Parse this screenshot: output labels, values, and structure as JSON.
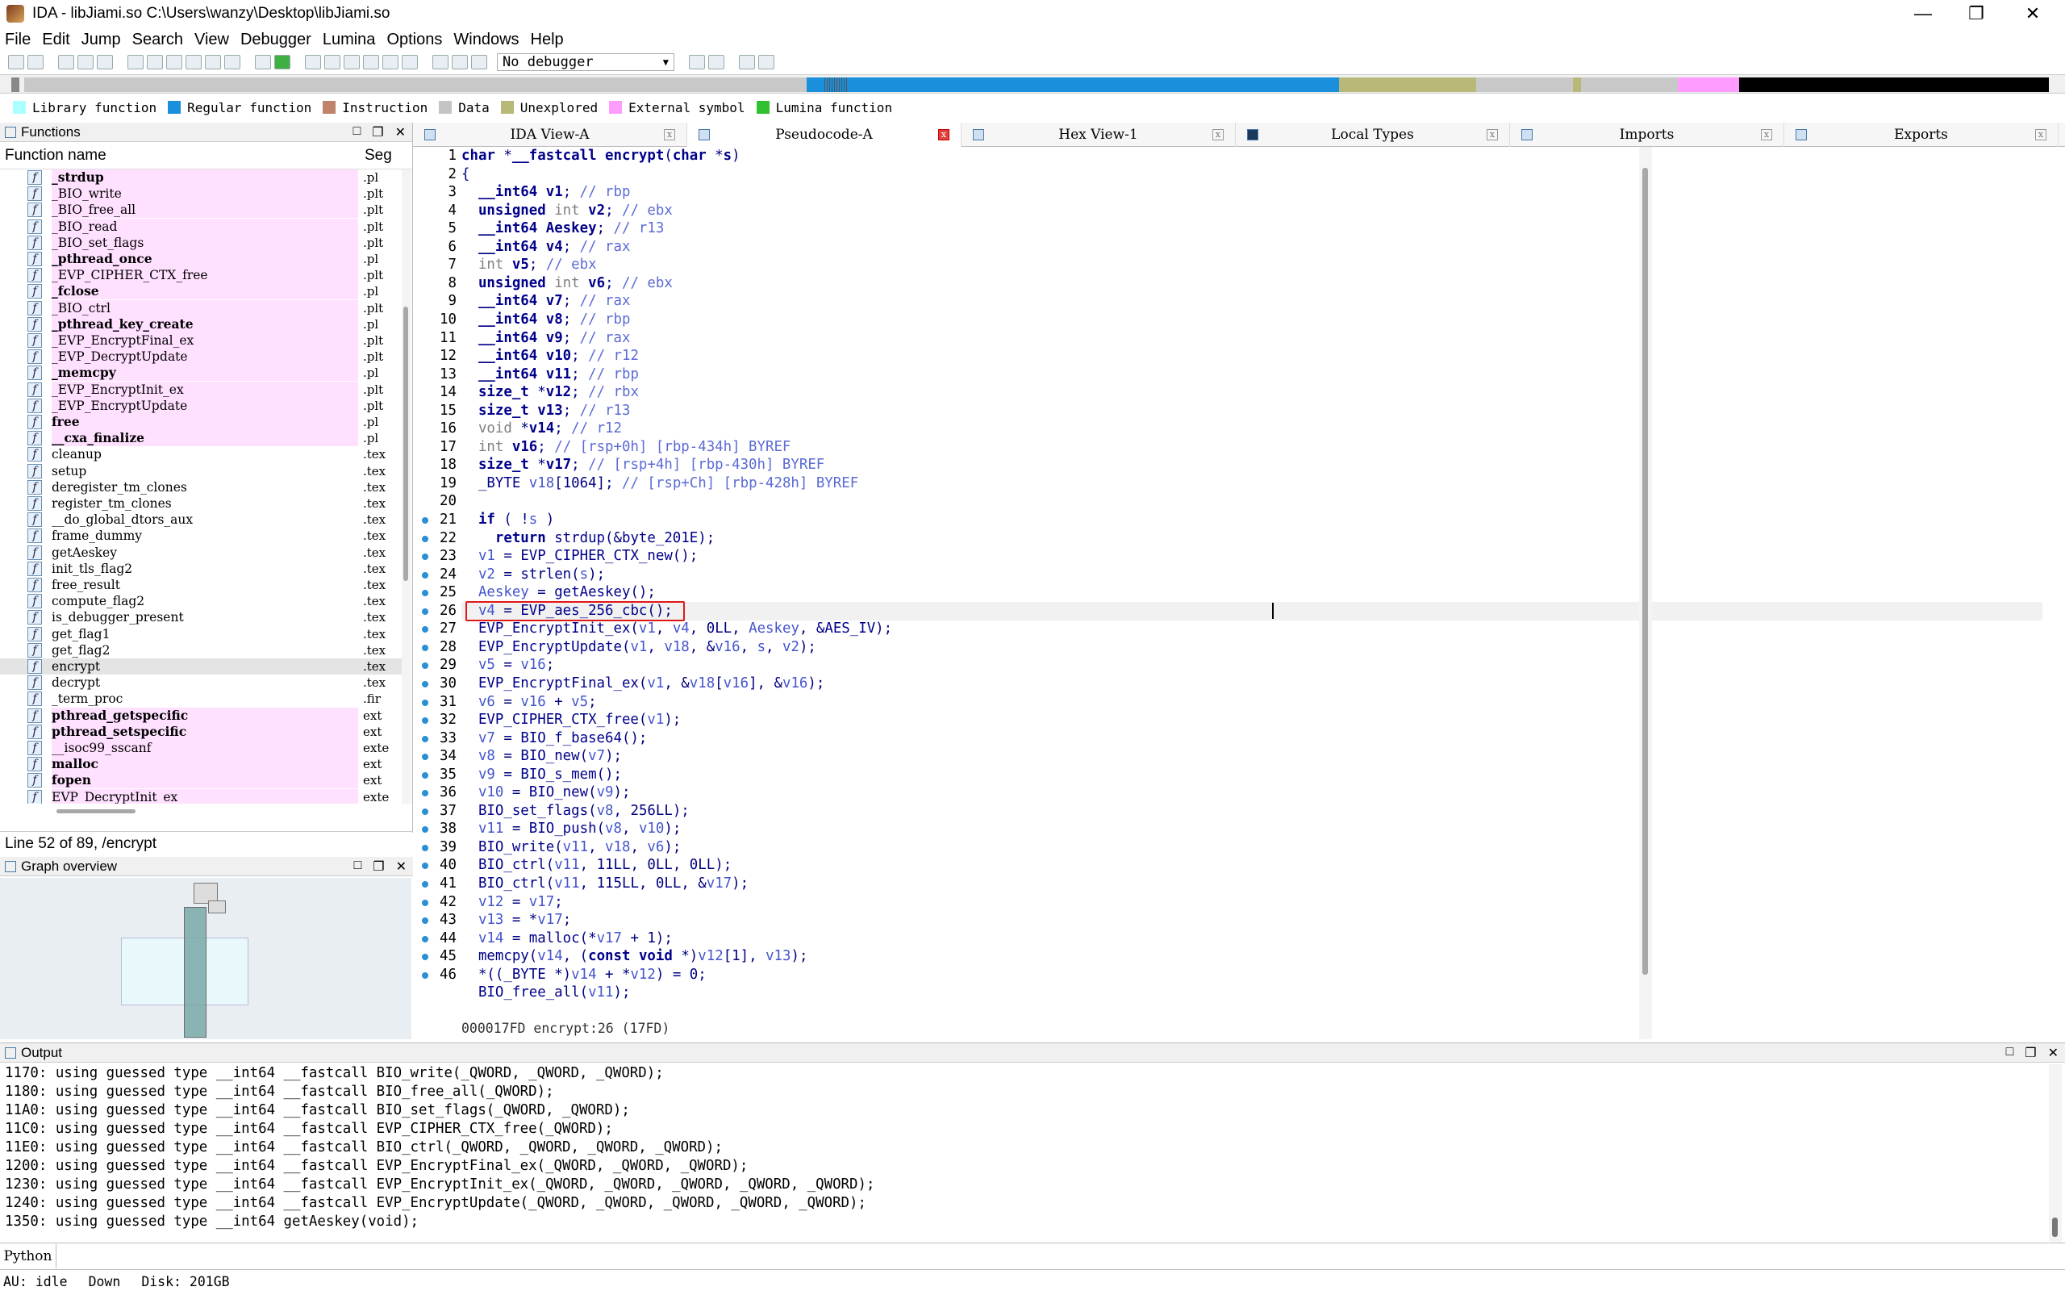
{
  "window": {
    "title": "IDA - libJiami.so C:\\Users\\wanzy\\Desktop\\libJiami.so"
  },
  "menu": [
    "File",
    "Edit",
    "Jump",
    "Search",
    "View",
    "Debugger",
    "Lumina",
    "Options",
    "Windows",
    "Help"
  ],
  "toolbar": {
    "debugger": "No debugger"
  },
  "legend": [
    {
      "label": "Library function",
      "color": "#aaffff"
    },
    {
      "label": "Regular function",
      "color": "#1a8fdc"
    },
    {
      "label": "Instruction",
      "color": "#c0826a"
    },
    {
      "label": "Data",
      "color": "#c4c4c4"
    },
    {
      "label": "Unexplored",
      "color": "#b8b878"
    },
    {
      "label": "External symbol",
      "color": "#ff9cff"
    },
    {
      "label": "Lumina function",
      "color": "#30c030"
    }
  ],
  "functions": {
    "title": "Functions",
    "col_name": "Function name",
    "col_seg": "Seg",
    "line_info": "Line 52 of 89, /encrypt",
    "rows": [
      {
        "name": "_strdup",
        "seg": ".pl",
        "lib": true,
        "bold": true
      },
      {
        "name": "_BIO_write",
        "seg": ".plt",
        "lib": true,
        "bold": false
      },
      {
        "name": "_BIO_free_all",
        "seg": ".plt",
        "lib": true,
        "bold": false
      },
      {
        "name": "_BIO_read",
        "seg": ".plt",
        "lib": true,
        "bold": false
      },
      {
        "name": "_BIO_set_flags",
        "seg": ".plt",
        "lib": true,
        "bold": false
      },
      {
        "name": "_pthread_once",
        "seg": ".pl",
        "lib": true,
        "bold": true
      },
      {
        "name": "_EVP_CIPHER_CTX_free",
        "seg": ".plt",
        "lib": true,
        "bold": false
      },
      {
        "name": "_fclose",
        "seg": ".pl",
        "lib": true,
        "bold": true
      },
      {
        "name": "_BIO_ctrl",
        "seg": ".plt",
        "lib": true,
        "bold": false
      },
      {
        "name": "_pthread_key_create",
        "seg": ".pl",
        "lib": true,
        "bold": true
      },
      {
        "name": "_EVP_EncryptFinal_ex",
        "seg": ".plt",
        "lib": true,
        "bold": false
      },
      {
        "name": "_EVP_DecryptUpdate",
        "seg": ".plt",
        "lib": true,
        "bold": false
      },
      {
        "name": "_memcpy",
        "seg": ".pl",
        "lib": true,
        "bold": true
      },
      {
        "name": "_EVP_EncryptInit_ex",
        "seg": ".plt",
        "lib": true,
        "bold": false
      },
      {
        "name": "_EVP_EncryptUpdate",
        "seg": ".plt",
        "lib": true,
        "bold": false
      },
      {
        "name": "free",
        "seg": ".pl",
        "lib": true,
        "bold": true
      },
      {
        "name": "__cxa_finalize",
        "seg": ".pl",
        "lib": true,
        "bold": true
      },
      {
        "name": "cleanup",
        "seg": ".tex",
        "lib": false,
        "bold": false
      },
      {
        "name": "setup",
        "seg": ".tex",
        "lib": false,
        "bold": false
      },
      {
        "name": "deregister_tm_clones",
        "seg": ".tex",
        "lib": false,
        "bold": false
      },
      {
        "name": "register_tm_clones",
        "seg": ".tex",
        "lib": false,
        "bold": false
      },
      {
        "name": "__do_global_dtors_aux",
        "seg": ".tex",
        "lib": false,
        "bold": false
      },
      {
        "name": "frame_dummy",
        "seg": ".tex",
        "lib": false,
        "bold": false
      },
      {
        "name": "getAeskey",
        "seg": ".tex",
        "lib": false,
        "bold": false
      },
      {
        "name": "init_tls_flag2",
        "seg": ".tex",
        "lib": false,
        "bold": false
      },
      {
        "name": "free_result",
        "seg": ".tex",
        "lib": false,
        "bold": false
      },
      {
        "name": "compute_flag2",
        "seg": ".tex",
        "lib": false,
        "bold": false
      },
      {
        "name": "is_debugger_present",
        "seg": ".tex",
        "lib": false,
        "bold": false
      },
      {
        "name": "get_flag1",
        "seg": ".tex",
        "lib": false,
        "bold": false
      },
      {
        "name": "get_flag2",
        "seg": ".tex",
        "lib": false,
        "bold": false
      },
      {
        "name": "encrypt",
        "seg": ".tex",
        "lib": false,
        "bold": false,
        "selected": true
      },
      {
        "name": "decrypt",
        "seg": ".tex",
        "lib": false,
        "bold": false
      },
      {
        "name": "_term_proc",
        "seg": ".fir",
        "lib": false,
        "bold": false
      },
      {
        "name": "pthread_getspecific",
        "seg": "ext",
        "lib": true,
        "bold": true
      },
      {
        "name": "pthread_setspecific",
        "seg": "ext",
        "lib": true,
        "bold": true
      },
      {
        "name": "__isoc99_sscanf",
        "seg": "exte",
        "lib": true,
        "bold": false
      },
      {
        "name": "malloc",
        "seg": "ext",
        "lib": true,
        "bold": true
      },
      {
        "name": "fopen",
        "seg": "ext",
        "lib": true,
        "bold": true
      },
      {
        "name": "EVP_DecryptInit_ex",
        "seg": "exte",
        "lib": true,
        "bold": false
      }
    ]
  },
  "graph_overview": {
    "title": "Graph overview"
  },
  "tabs": [
    {
      "label": "IDA View-A",
      "active": false
    },
    {
      "label": "Pseudocode-A",
      "active": true
    },
    {
      "label": "Hex View-1",
      "active": false
    },
    {
      "label": "Local Types",
      "active": false
    },
    {
      "label": "Imports",
      "active": false
    },
    {
      "label": "Exports",
      "active": false
    }
  ],
  "pseudocode": {
    "status": "000017FD encrypt:26 (17FD)",
    "highlighted_line": 26,
    "lines": [
      {
        "n": "1",
        "text": "char *__fastcall encrypt(char *s)",
        "dot": false
      },
      {
        "n": "2",
        "text": "{",
        "dot": false
      },
      {
        "n": "3",
        "text": "  __int64 v1; // rbp",
        "dot": false
      },
      {
        "n": "4",
        "text": "  unsigned int v2; // ebx",
        "dot": false
      },
      {
        "n": "5",
        "text": "  __int64 Aeskey; // r13",
        "dot": false
      },
      {
        "n": "6",
        "text": "  __int64 v4; // rax",
        "dot": false
      },
      {
        "n": "7",
        "text": "  int v5; // ebx",
        "dot": false
      },
      {
        "n": "8",
        "text": "  unsigned int v6; // ebx",
        "dot": false
      },
      {
        "n": "9",
        "text": "  __int64 v7; // rax",
        "dot": false
      },
      {
        "n": "10",
        "text": "  __int64 v8; // rbp",
        "dot": false
      },
      {
        "n": "11",
        "text": "  __int64 v9; // rax",
        "dot": false
      },
      {
        "n": "12",
        "text": "  __int64 v10; // r12",
        "dot": false
      },
      {
        "n": "13",
        "text": "  __int64 v11; // rbp",
        "dot": false
      },
      {
        "n": "14",
        "text": "  size_t *v12; // rbx",
        "dot": false
      },
      {
        "n": "15",
        "text": "  size_t v13; // r13",
        "dot": false
      },
      {
        "n": "16",
        "text": "  void *v14; // r12",
        "dot": false
      },
      {
        "n": "17",
        "text": "  int v16; // [rsp+0h] [rbp-434h] BYREF",
        "dot": false
      },
      {
        "n": "18",
        "text": "  size_t *v17; // [rsp+4h] [rbp-430h] BYREF",
        "dot": false
      },
      {
        "n": "19",
        "text": "  _BYTE v18[1064]; // [rsp+Ch] [rbp-428h] BYREF",
        "dot": false
      },
      {
        "n": "20",
        "text": "",
        "dot": false
      },
      {
        "n": "21",
        "text": "  if ( !s )",
        "dot": true
      },
      {
        "n": "22",
        "text": "    return strdup(&byte_201E);",
        "dot": true
      },
      {
        "n": "23",
        "text": "  v1 = EVP_CIPHER_CTX_new();",
        "dot": true
      },
      {
        "n": "24",
        "text": "  v2 = strlen(s);",
        "dot": true
      },
      {
        "n": "25",
        "text": "  Aeskey = getAeskey();",
        "dot": true
      },
      {
        "n": "26",
        "text": "  v4 = EVP_aes_256_cbc();",
        "dot": true
      },
      {
        "n": "27",
        "text": "  EVP_EncryptInit_ex(v1, v4, 0LL, Aeskey, &AES_IV);",
        "dot": true
      },
      {
        "n": "28",
        "text": "  EVP_EncryptUpdate(v1, v18, &v16, s, v2);",
        "dot": true
      },
      {
        "n": "29",
        "text": "  v5 = v16;",
        "dot": true
      },
      {
        "n": "30",
        "text": "  EVP_EncryptFinal_ex(v1, &v18[v16], &v16);",
        "dot": true
      },
      {
        "n": "31",
        "text": "  v6 = v16 + v5;",
        "dot": true
      },
      {
        "n": "32",
        "text": "  EVP_CIPHER_CTX_free(v1);",
        "dot": true
      },
      {
        "n": "33",
        "text": "  v7 = BIO_f_base64();",
        "dot": true
      },
      {
        "n": "34",
        "text": "  v8 = BIO_new(v7);",
        "dot": true
      },
      {
        "n": "35",
        "text": "  v9 = BIO_s_mem();",
        "dot": true
      },
      {
        "n": "36",
        "text": "  v10 = BIO_new(v9);",
        "dot": true
      },
      {
        "n": "37",
        "text": "  BIO_set_flags(v8, 256LL);",
        "dot": true
      },
      {
        "n": "38",
        "text": "  v11 = BIO_push(v8, v10);",
        "dot": true
      },
      {
        "n": "39",
        "text": "  BIO_write(v11, v18, v6);",
        "dot": true
      },
      {
        "n": "40",
        "text": "  BIO_ctrl(v11, 11LL, 0LL, 0LL);",
        "dot": true
      },
      {
        "n": "41",
        "text": "  BIO_ctrl(v11, 115LL, 0LL, &v17);",
        "dot": true
      },
      {
        "n": "42",
        "text": "  v12 = v17;",
        "dot": true
      },
      {
        "n": "43",
        "text": "  v13 = *v17;",
        "dot": true
      },
      {
        "n": "44",
        "text": "  v14 = malloc(*v17 + 1);",
        "dot": true
      },
      {
        "n": "45",
        "text": "  memcpy(v14, (const void *)v12[1], v13);",
        "dot": true
      },
      {
        "n": "46",
        "text": "  *((_BYTE *)v14 + *v12) = 0;",
        "dot": true
      },
      {
        "n": "",
        "text": "  BIO_free_all(v11);",
        "dot": false
      }
    ]
  },
  "output": {
    "title": "Output",
    "lines": [
      "1170: using guessed type __int64 __fastcall BIO_write(_QWORD, _QWORD, _QWORD);",
      "1180: using guessed type __int64 __fastcall BIO_free_all(_QWORD);",
      "11A0: using guessed type __int64 __fastcall BIO_set_flags(_QWORD, _QWORD);",
      "11C0: using guessed type __int64 __fastcall EVP_CIPHER_CTX_free(_QWORD);",
      "11E0: using guessed type __int64 __fastcall BIO_ctrl(_QWORD, _QWORD, _QWORD, _QWORD);",
      "1200: using guessed type __int64 __fastcall EVP_EncryptFinal_ex(_QWORD, _QWORD, _QWORD);",
      "1230: using guessed type __int64 __fastcall EVP_EncryptInit_ex(_QWORD, _QWORD, _QWORD, _QWORD, _QWORD);",
      "1240: using guessed type __int64 __fastcall EVP_EncryptUpdate(_QWORD, _QWORD, _QWORD, _QWORD, _QWORD);",
      "1350: using guessed type __int64 getAeskey(void);"
    ]
  },
  "python_button": "Python",
  "status": {
    "au": "AU:",
    "state": "idle",
    "direction": "Down",
    "disk": "Disk: 201GB"
  }
}
